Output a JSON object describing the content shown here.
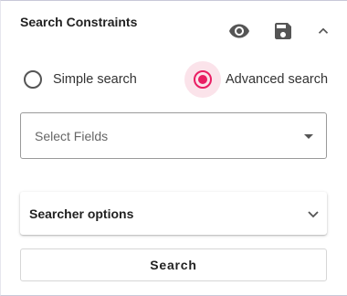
{
  "header": {
    "title": "Search Constraints",
    "icons": [
      "eye-icon",
      "save-icon",
      "chevron-up-icon"
    ]
  },
  "search_mode": {
    "options": [
      {
        "label": "Simple search",
        "selected": false
      },
      {
        "label": "Advanced search",
        "selected": true
      }
    ],
    "accent_color": "#e91e63"
  },
  "fields_select": {
    "placeholder": "Select Fields"
  },
  "searcher_options": {
    "label": "Searcher options",
    "expanded": false
  },
  "search_button": {
    "label": "Search"
  }
}
